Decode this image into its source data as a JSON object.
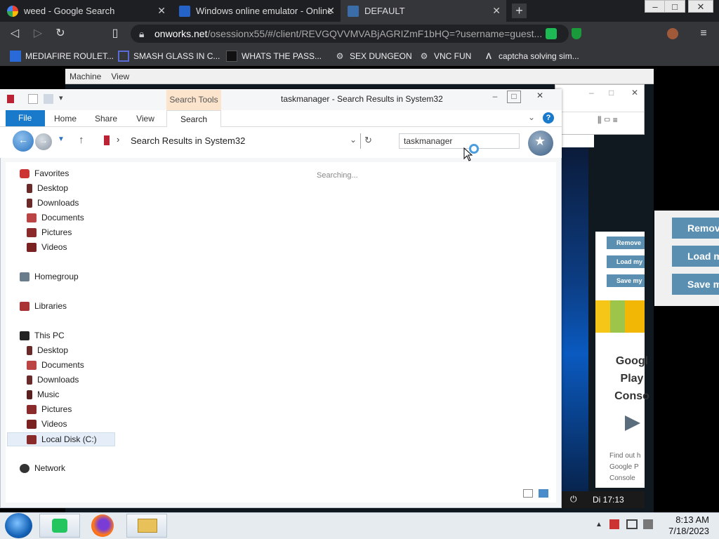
{
  "browser": {
    "tabs": [
      {
        "title": "weed - Google Search",
        "icon": "google-icon"
      },
      {
        "title": "Windows online emulator - Online",
        "icon": "onworks-icon"
      },
      {
        "title": "DEFAULT",
        "icon": "screen-icon"
      }
    ],
    "new_tab_label": "+",
    "close_glyph": "✕",
    "url_host": "onworks.net",
    "url_rest": "/osessionx55/#/client/REVGQVVMVABjAGRIZmF1bHQ=?username=guest...",
    "bookmarks": [
      "MEDIAFIRE ROULET...",
      "SMASH GLASS IN C...",
      "WHATS THE PASS...",
      "SEX DUNGEON",
      "VNC FUN",
      "captcha solving sim..."
    ]
  },
  "vm_menu": {
    "items": [
      "Machine",
      "View"
    ]
  },
  "explorer": {
    "title": "taskmanager - Search Results in System32",
    "context_tab": "Search Tools",
    "ribbon_tabs": [
      "File",
      "Home",
      "Share",
      "View",
      "Search"
    ],
    "address": "Search Results in System32",
    "search_value": "taskmanager",
    "status_text": "Searching...",
    "nav": {
      "favorites": "Favorites",
      "favorites_items": [
        "Desktop",
        "Downloads",
        "Documents",
        "Pictures",
        "Videos"
      ],
      "homegroup": "Homegroup",
      "libraries": "Libraries",
      "this_pc": "This PC",
      "this_pc_items": [
        "Desktop",
        "Documents",
        "Downloads",
        "Music",
        "Pictures",
        "Videos",
        "Local Disk (C:)"
      ],
      "network": "Network"
    }
  },
  "background": {
    "ad_buttons": [
      "Remove",
      "Load my",
      "Save my"
    ],
    "right_buttons": [
      "Remov",
      "Load m",
      "Save m"
    ],
    "ad_lines": [
      "Googl",
      "Play",
      "Conso"
    ],
    "ad_small": [
      "Find out h",
      "Google P",
      "Console"
    ],
    "vm_clock": "Di 17:13"
  },
  "taskbar": {
    "time": "8:13 AM",
    "date": "7/18/2023"
  },
  "colors": {
    "accent": "#1979ca",
    "context_tab": "#fbe3cc",
    "ad_button": "#5a8fb2"
  }
}
